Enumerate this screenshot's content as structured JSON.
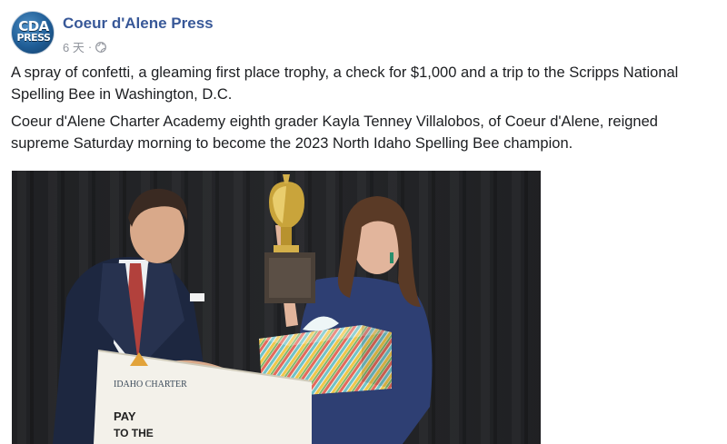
{
  "post": {
    "page_name": "Coeur d'Alene Press",
    "avatar_text_top": "CDA",
    "avatar_text_bottom": "PRESS",
    "timestamp": "6 天",
    "separator": "·",
    "privacy_icon": "globe-icon",
    "paragraphs": [
      "A spray of confetti, a gleaming first place trophy, a check for $1,000 and a trip to the Scripps National Spelling Bee in Washington, D.C.",
      "Coeur d'Alene Charter Academy eighth grader Kayla Tenney Villalobos, of Coeur d'Alene, reigned supreme Saturday morning to become the 2023 North Idaho Spelling Bee champion."
    ]
  },
  "photo": {
    "check_text_brand": "IDAHO CHARTER",
    "check_text_pay": "PAY",
    "check_text_to": "TO THE"
  },
  "colors": {
    "page_name": "#385898",
    "meta": "#90949c",
    "text": "#1c1e21"
  }
}
